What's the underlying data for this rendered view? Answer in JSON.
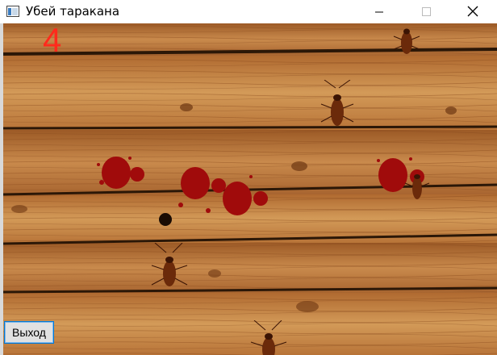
{
  "window": {
    "title": "Убей таракана"
  },
  "game": {
    "score": "4",
    "exit_label": "Выход"
  },
  "colors": {
    "score": "#ff2a1c",
    "blood": "#a00b0b",
    "wood": "#b8733a"
  }
}
